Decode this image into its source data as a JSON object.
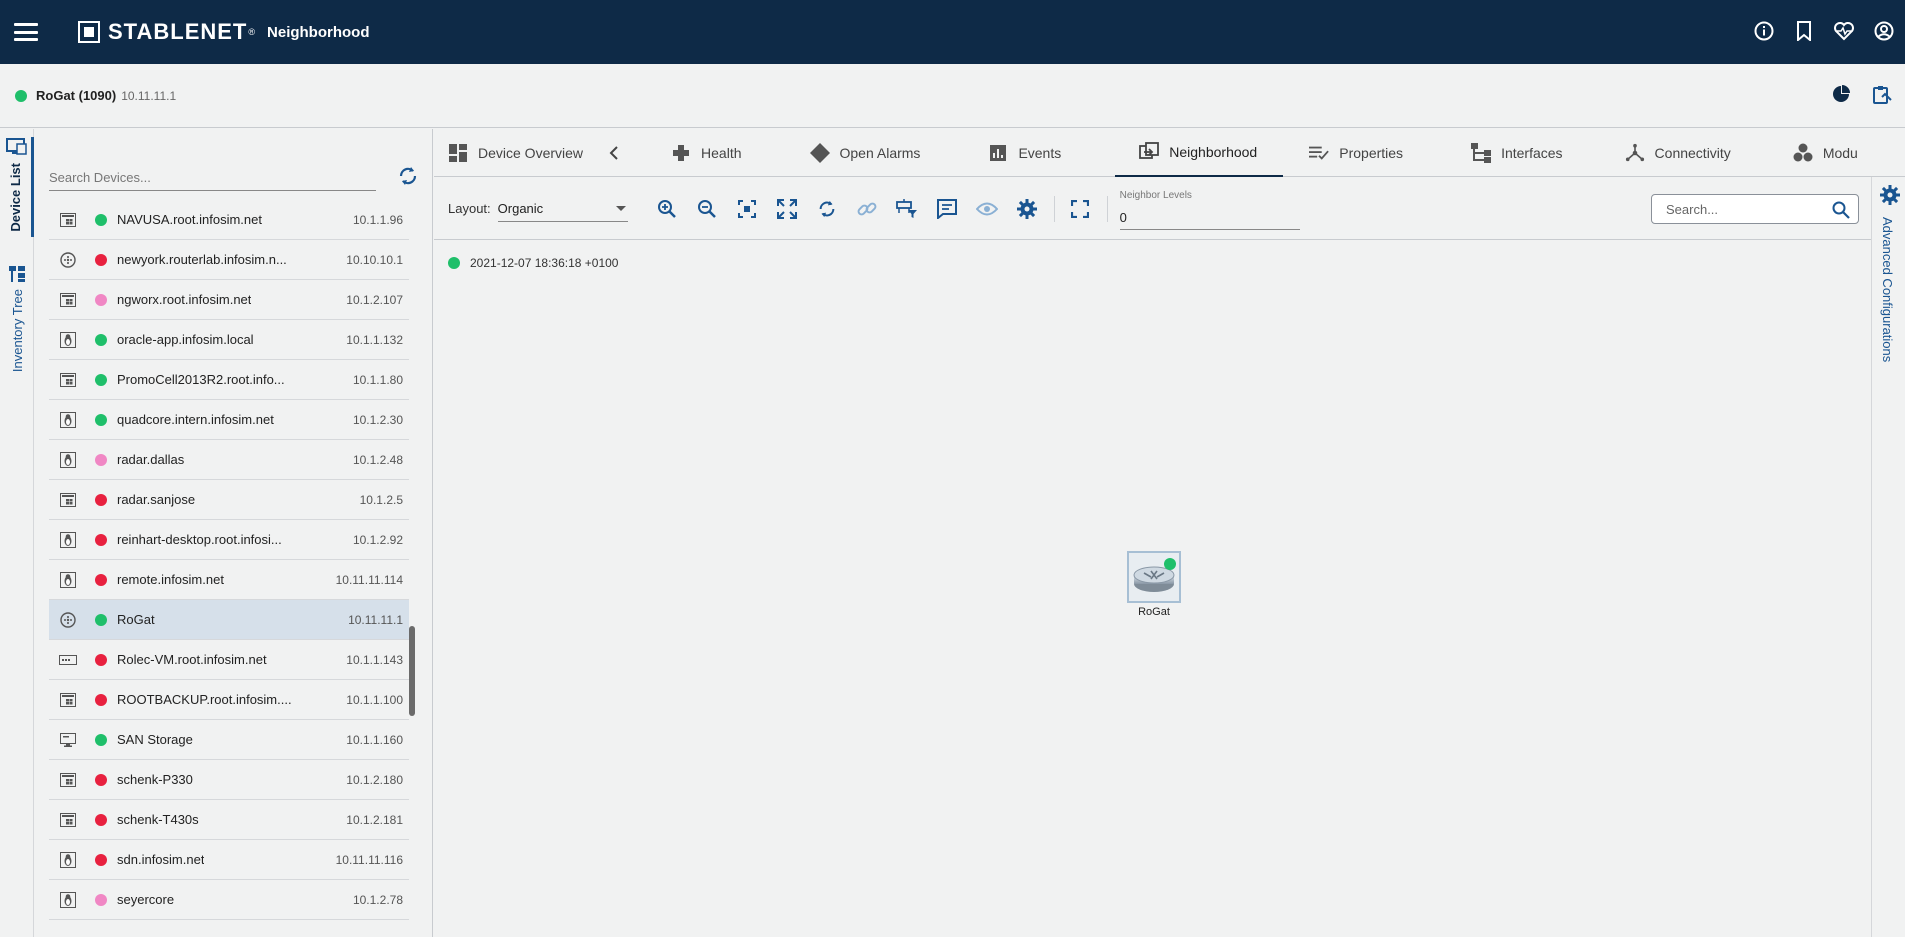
{
  "header": {
    "brand": "STABLENET",
    "brand_reg": "®",
    "app_title": "Neighborhood",
    "icons": [
      "info-icon",
      "bookmark-icon",
      "health-heart-icon",
      "account-icon"
    ]
  },
  "device_header": {
    "status": "green",
    "name": "RoGat (1090)",
    "ip": "10.11.11.1",
    "icons": [
      "pie-chart-icon",
      "clipboard-icon"
    ]
  },
  "side_tabs": {
    "device_list": "Device List",
    "inventory_tree": "Inventory Tree"
  },
  "device_list": {
    "search_placeholder": "Search Devices...",
    "rows": [
      {
        "type": "windows",
        "status": "green",
        "name": "NAVUSA.root.infosim.net",
        "ip": "10.1.1.96"
      },
      {
        "type": "router",
        "status": "red",
        "name": "newyork.routerlab.infosim.n...",
        "ip": "10.10.10.1"
      },
      {
        "type": "windows",
        "status": "pink",
        "name": "ngworx.root.infosim.net",
        "ip": "10.1.2.107"
      },
      {
        "type": "linux",
        "status": "green",
        "name": "oracle-app.infosim.local",
        "ip": "10.1.1.132"
      },
      {
        "type": "windows",
        "status": "green",
        "name": "PromoCell2013R2.root.info...",
        "ip": "10.1.1.80"
      },
      {
        "type": "linux",
        "status": "green",
        "name": "quadcore.intern.infosim.net",
        "ip": "10.1.2.30"
      },
      {
        "type": "linux",
        "status": "pink",
        "name": "radar.dallas",
        "ip": "10.1.2.48"
      },
      {
        "type": "windows",
        "status": "red",
        "name": "radar.sanjose",
        "ip": "10.1.2.5"
      },
      {
        "type": "linux",
        "status": "red",
        "name": "reinhart-desktop.root.infosi...",
        "ip": "10.1.2.92"
      },
      {
        "type": "linux",
        "status": "red",
        "name": "remote.infosim.net",
        "ip": "10.11.11.114"
      },
      {
        "type": "router",
        "status": "green",
        "name": "RoGat",
        "ip": "10.11.11.1",
        "selected": true
      },
      {
        "type": "server",
        "status": "red",
        "name": "Rolec-VM.root.infosim.net",
        "ip": "10.1.1.143"
      },
      {
        "type": "windows",
        "status": "red",
        "name": "ROOTBACKUP.root.infosim....",
        "ip": "10.1.1.100"
      },
      {
        "type": "monitor",
        "status": "green",
        "name": "SAN Storage",
        "ip": "10.1.1.160"
      },
      {
        "type": "windows",
        "status": "red",
        "name": "schenk-P330",
        "ip": "10.1.2.180"
      },
      {
        "type": "windows",
        "status": "red",
        "name": "schenk-T430s",
        "ip": "10.1.2.181"
      },
      {
        "type": "linux",
        "status": "red",
        "name": "sdn.infosim.net",
        "ip": "10.11.11.116"
      },
      {
        "type": "linux",
        "status": "pink",
        "name": "seyercore",
        "ip": "10.1.2.78"
      }
    ]
  },
  "tabs": [
    {
      "label": "Device Overview",
      "icon": "dashboard-icon"
    },
    {
      "label": "Health",
      "icon": "plus-cross-icon"
    },
    {
      "label": "Open Alarms",
      "icon": "diamond-icon"
    },
    {
      "label": "Events",
      "icon": "bar-chart-icon"
    },
    {
      "label": "Neighborhood",
      "icon": "neighborhood-icon",
      "active": true
    },
    {
      "label": "Properties",
      "icon": "properties-list-icon"
    },
    {
      "label": "Interfaces",
      "icon": "interfaces-tree-icon"
    },
    {
      "label": "Connectivity",
      "icon": "connectivity-icon"
    },
    {
      "label": "Modu",
      "icon": "modules-icon"
    }
  ],
  "toolbar": {
    "layout_label": "Layout:",
    "layout_value": "Organic",
    "neighbor_levels_label": "Neighbor Levels",
    "neighbor_levels_value": "0",
    "search_placeholder": "Search..."
  },
  "canvas": {
    "timestamp": "2021-12-07 18:36:18 +0100",
    "timestamp_status": "green",
    "node_label": "RoGat",
    "node_status": "green"
  },
  "right_panel": {
    "label": "Advanced Configurations"
  },
  "colors": {
    "navy": "#0e2a47",
    "accent_blue": "#1a5591",
    "status_green": "#1fbf6a",
    "status_red": "#e8213f",
    "status_pink": "#f087c4",
    "selected_row": "#d6e0ea"
  }
}
